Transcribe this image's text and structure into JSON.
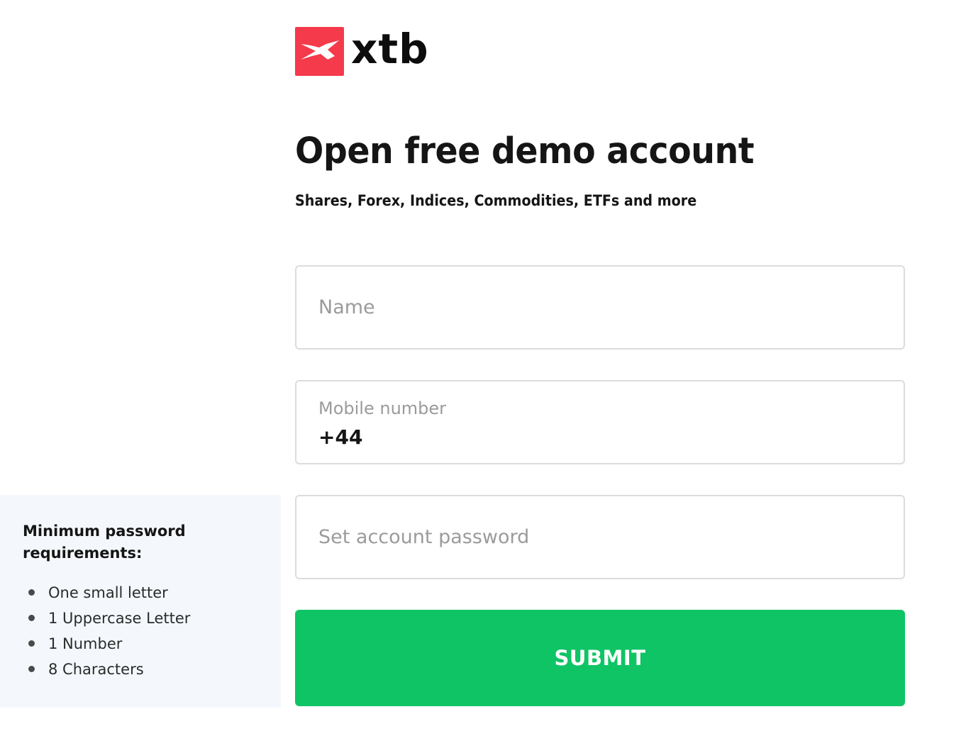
{
  "logo": {
    "brand": "xtb",
    "icon": "xtb-logo-icon",
    "brand_color": "#f43a4b"
  },
  "header": {
    "title": "Open free demo account",
    "subtitle": "Shares, Forex, Indices, Commodities, ETFs and more"
  },
  "form": {
    "name": {
      "placeholder": "Name",
      "value": ""
    },
    "mobile": {
      "label": "Mobile number",
      "prefix": "+44"
    },
    "password": {
      "placeholder": "Set account password",
      "value": ""
    },
    "submit_label": "SUBMIT",
    "submit_color": "#0fc465"
  },
  "password_requirements": {
    "title": "Minimum password requirements:",
    "items": [
      "One small letter",
      "1 Uppercase Letter",
      "1 Number",
      "8 Characters"
    ]
  }
}
